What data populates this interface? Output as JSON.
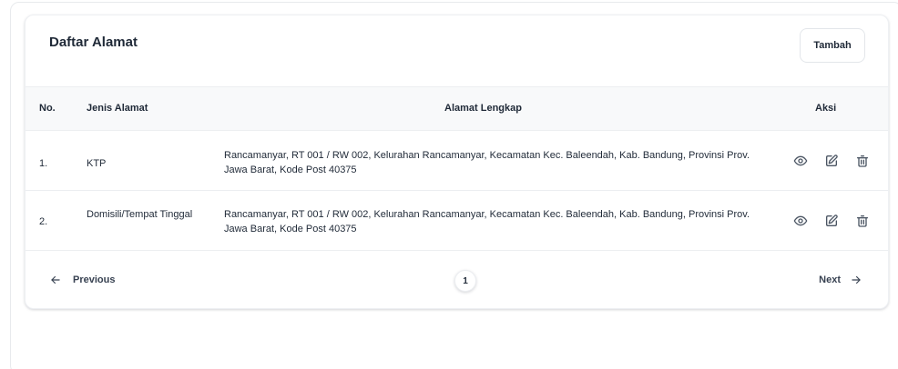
{
  "card": {
    "title": "Daftar Alamat",
    "add_label": "Tambah"
  },
  "table": {
    "headers": {
      "no": "No.",
      "jenis": "Jenis Alamat",
      "alamat": "Alamat Lengkap",
      "aksi": "Aksi"
    },
    "rows": [
      {
        "no": "1.",
        "jenis": "KTP",
        "alamat": "Rancamanyar, RT 001 / RW 002, Kelurahan Rancamanyar, Kecamatan Kec. Baleendah, Kab. Bandung, Provinsi Prov. Jawa Barat, Kode Post 40375"
      },
      {
        "no": "2.",
        "jenis": "Domisili/Tempat Tinggal",
        "alamat": "Rancamanyar, RT 001 / RW 002, Kelurahan Rancamanyar, Kecamatan Kec. Baleendah, Kab. Bandung, Provinsi Prov. Jawa Barat, Kode Post 40375"
      }
    ],
    "actions": [
      "eye-icon",
      "edit-icon",
      "trash-icon"
    ]
  },
  "pagination": {
    "previous_label": "Previous",
    "next_label": "Next",
    "current_page": "1"
  }
}
